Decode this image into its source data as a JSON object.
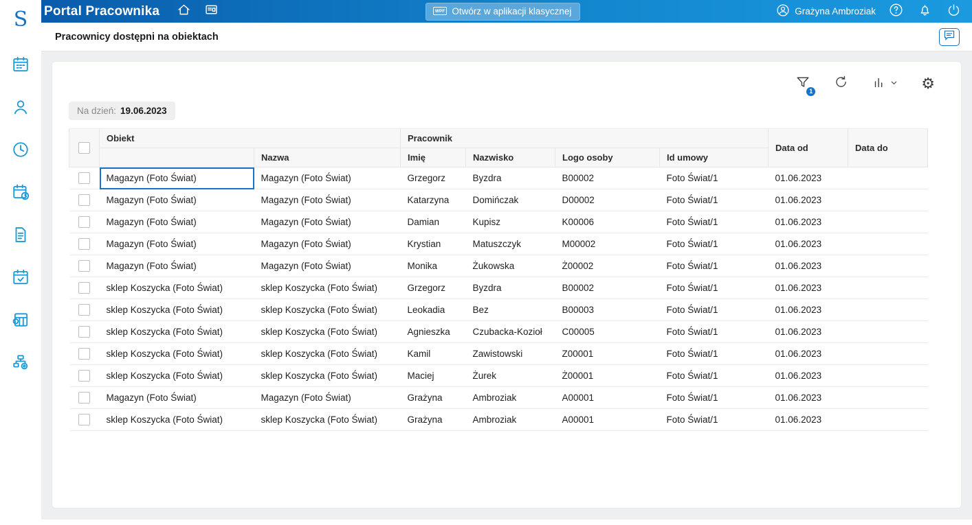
{
  "app": {
    "logo_letter": "S",
    "title": "Portal Pracownika",
    "open_classic_label": "Otwórz w aplikacji klasycznej",
    "wpf_label": "WPF",
    "user_name": "Grażyna Ambroziak"
  },
  "page": {
    "title": "Pracownicy dostępni na obiektach"
  },
  "toolbar": {
    "filter_badge": "1",
    "date_label": "Na dzień:",
    "date_value": "19.06.2023"
  },
  "icons": {
    "sidebar": [
      "calendar-icon",
      "people-icon",
      "clock-icon",
      "schedule-clock-icon",
      "document-icon",
      "calendar-check-icon",
      "worksheet-icon",
      "structure-settings-icon"
    ],
    "topbar": [
      "home-icon",
      "news-panel-icon",
      "user-icon",
      "help-icon",
      "bell-icon",
      "power-icon"
    ],
    "card_toolbar": [
      "filter-icon",
      "refresh-icon",
      "chart-dropdown-icon",
      "gear-icon"
    ],
    "subheader": [
      "chat-icon"
    ],
    "colors": {
      "accent": "#1673c5",
      "sidebar_icon": "#1b9ad6",
      "topbar_gradient": [
        "#0a5cab",
        "#1b9ae0"
      ]
    }
  },
  "table": {
    "group_headers": {
      "obiekt": "Obiekt",
      "pracownik": "Pracownik",
      "data_od": "Data od",
      "data_do": "Data do"
    },
    "sub_headers": {
      "nazwa": "Nazwa",
      "imie": "Imię",
      "nazwisko": "Nazwisko",
      "logo_osoby": "Logo osoby",
      "id_umowy": "Id umowy"
    },
    "columns": [
      "obiekt",
      "nazwa",
      "imie",
      "nazwisko",
      "logo",
      "umowa",
      "od",
      "do"
    ],
    "rows": [
      {
        "obiekt": "Magazyn (Foto Świat)",
        "nazwa": "Magazyn (Foto Świat)",
        "imie": "Grzegorz",
        "nazwisko": "Byzdra",
        "logo": "B00002",
        "umowa": "Foto Świat/1",
        "od": "01.06.2023",
        "do": ""
      },
      {
        "obiekt": "Magazyn (Foto Świat)",
        "nazwa": "Magazyn (Foto Świat)",
        "imie": "Katarzyna",
        "nazwisko": "Domińczak",
        "logo": "D00002",
        "umowa": "Foto Świat/1",
        "od": "01.06.2023",
        "do": ""
      },
      {
        "obiekt": "Magazyn (Foto Świat)",
        "nazwa": "Magazyn (Foto Świat)",
        "imie": "Damian",
        "nazwisko": "Kupisz",
        "logo": "K00006",
        "umowa": "Foto Świat/1",
        "od": "01.06.2023",
        "do": ""
      },
      {
        "obiekt": "Magazyn (Foto Świat)",
        "nazwa": "Magazyn (Foto Świat)",
        "imie": "Krystian",
        "nazwisko": "Matuszczyk",
        "logo": "M00002",
        "umowa": "Foto Świat/1",
        "od": "01.06.2023",
        "do": ""
      },
      {
        "obiekt": "Magazyn (Foto Świat)",
        "nazwa": "Magazyn (Foto Świat)",
        "imie": "Monika",
        "nazwisko": "Żukowska",
        "logo": "Ż00002",
        "umowa": "Foto Świat/1",
        "od": "01.06.2023",
        "do": ""
      },
      {
        "obiekt": "sklep Koszycka (Foto Świat)",
        "nazwa": "sklep Koszycka (Foto Świat)",
        "imie": "Grzegorz",
        "nazwisko": "Byzdra",
        "logo": "B00002",
        "umowa": "Foto Świat/1",
        "od": "01.06.2023",
        "do": ""
      },
      {
        "obiekt": "sklep Koszycka (Foto Świat)",
        "nazwa": "sklep Koszycka (Foto Świat)",
        "imie": "Leokadia",
        "nazwisko": "Bez",
        "logo": "B00003",
        "umowa": "Foto Świat/1",
        "od": "01.06.2023",
        "do": ""
      },
      {
        "obiekt": "sklep Koszycka (Foto Świat)",
        "nazwa": "sklep Koszycka (Foto Świat)",
        "imie": "Agnieszka",
        "nazwisko": "Czubacka-Kozioł",
        "logo": "C00005",
        "umowa": "Foto Świat/1",
        "od": "01.06.2023",
        "do": ""
      },
      {
        "obiekt": "sklep Koszycka (Foto Świat)",
        "nazwa": "sklep Koszycka (Foto Świat)",
        "imie": "Kamil",
        "nazwisko": "Zawistowski",
        "logo": "Z00001",
        "umowa": "Foto Świat/1",
        "od": "01.06.2023",
        "do": ""
      },
      {
        "obiekt": "sklep Koszycka (Foto Świat)",
        "nazwa": "sklep Koszycka (Foto Świat)",
        "imie": "Maciej",
        "nazwisko": "Żurek",
        "logo": "Ż00001",
        "umowa": "Foto Świat/1",
        "od": "01.06.2023",
        "do": ""
      },
      {
        "obiekt": "Magazyn (Foto Świat)",
        "nazwa": "Magazyn (Foto Świat)",
        "imie": "Grażyna",
        "nazwisko": "Ambroziak",
        "logo": "A00001",
        "umowa": "Foto Świat/1",
        "od": "01.06.2023",
        "do": ""
      },
      {
        "obiekt": "sklep Koszycka (Foto Świat)",
        "nazwa": "sklep Koszycka (Foto Świat)",
        "imie": "Grażyna",
        "nazwisko": "Ambroziak",
        "logo": "A00001",
        "umowa": "Foto Świat/1",
        "od": "01.06.2023",
        "do": ""
      }
    ]
  }
}
